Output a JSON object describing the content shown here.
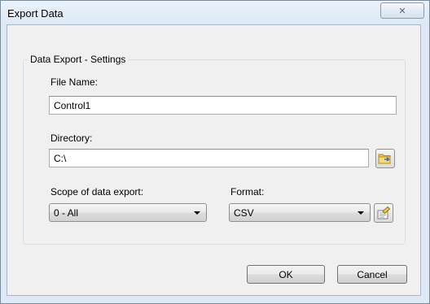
{
  "window": {
    "title": "Export Data",
    "close_glyph": "✕"
  },
  "settings": {
    "group_title": "Data Export - Settings",
    "file_name_label": "File Name:",
    "file_name_value": "Control1",
    "directory_label": "Directory:",
    "directory_value": "C:\\",
    "browse_icon": "folder-browse-icon",
    "scope_label": "Scope of data export:",
    "scope_value": "0 - All",
    "format_label": "Format:",
    "format_value": "CSV",
    "format_options_icon": "format-settings-icon"
  },
  "buttons": {
    "ok_label": "OK",
    "cancel_label": "Cancel"
  },
  "colors": {
    "frame": "#dfe9f5",
    "client": "#f0f0f0",
    "folder_yellow": "#f3c64d",
    "arrow_blue": "#2f6fcf"
  }
}
